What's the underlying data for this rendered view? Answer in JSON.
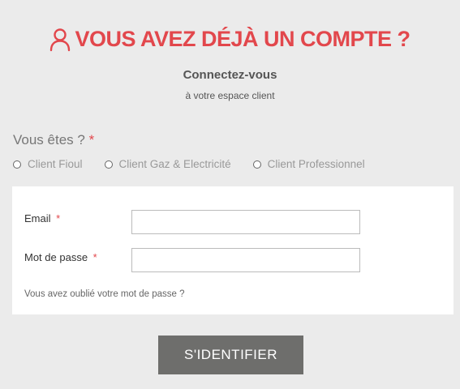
{
  "header": {
    "title": "VOUS AVEZ DÉJÀ UN COMPTE ?",
    "icon": "user-icon",
    "accent_color": "#e2474c"
  },
  "intro": {
    "subtitle": "Connectez-vous",
    "sub_subtitle": "à votre espace client"
  },
  "customer_type": {
    "question": "Vous êtes ?",
    "required_mark": "*",
    "options": [
      {
        "label": "Client Fioul",
        "selected": false
      },
      {
        "label": "Client Gaz & Electricité",
        "selected": false
      },
      {
        "label": "Client Professionnel",
        "selected": false
      }
    ]
  },
  "login_form": {
    "email_label": "Email",
    "email_value": "",
    "password_label": "Mot de passe",
    "password_value": "",
    "required_mark": "*",
    "forgot_password": "Vous avez oublié votre mot de passe ?"
  },
  "submit": {
    "label": "S'IDENTIFIER",
    "color": "#6e6e6c"
  }
}
